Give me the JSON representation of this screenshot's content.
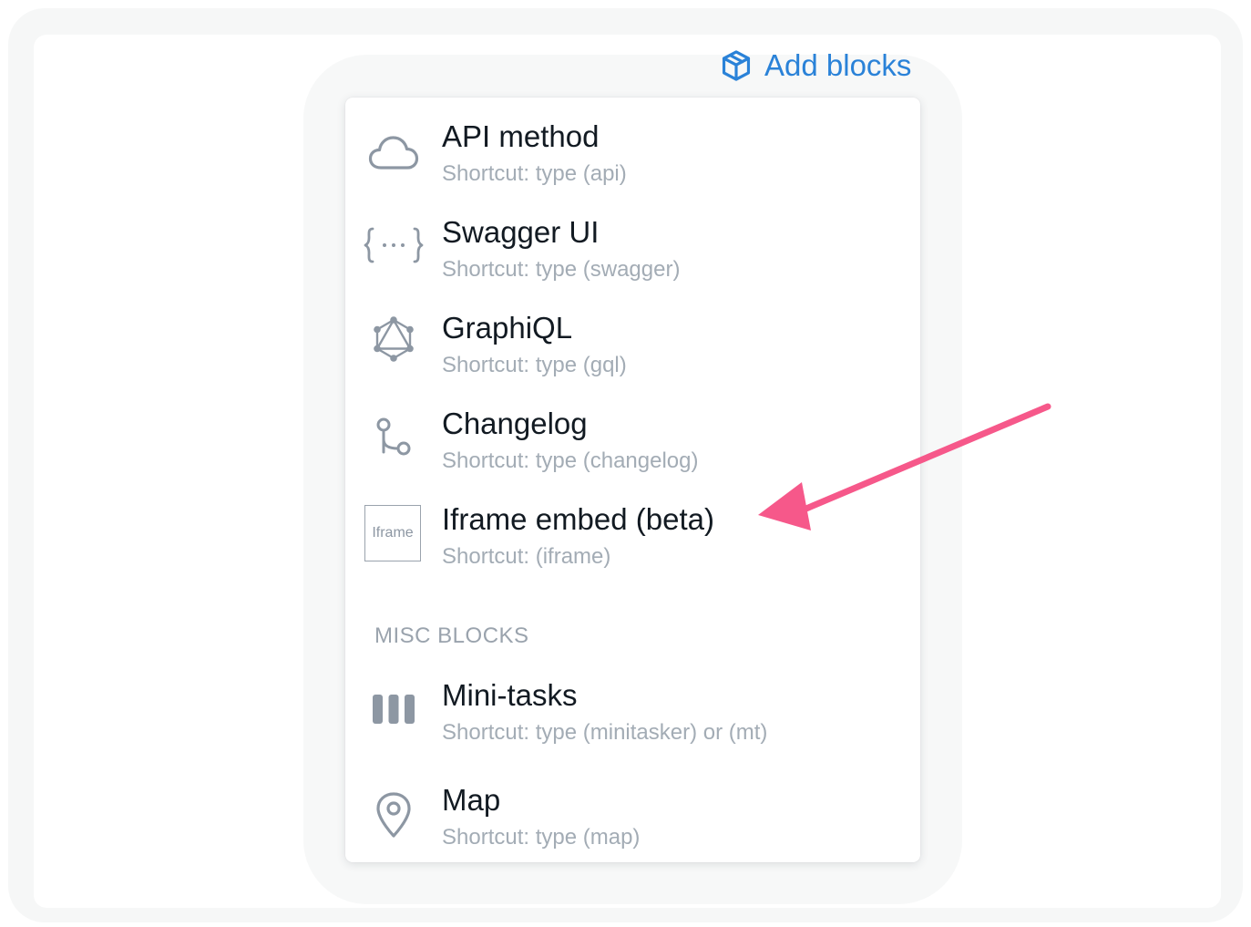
{
  "header": {
    "add_blocks_label": "Add blocks",
    "add_blocks_icon": "cube-icon",
    "accent_color": "#2a82d8"
  },
  "menu": {
    "items": [
      {
        "title": "API method",
        "shortcut": "Shortcut:  type (api)",
        "icon": "cloud-icon"
      },
      {
        "title": "Swagger UI",
        "shortcut": "Shortcut:  type (swagger)",
        "icon": "curly-braces-icon"
      },
      {
        "title": "GraphiQL",
        "shortcut": "Shortcut:  type (gql)",
        "icon": "graphql-icon"
      },
      {
        "title": "Changelog",
        "shortcut": "Shortcut:  type (changelog)",
        "icon": "git-branch-icon"
      },
      {
        "title": "Iframe embed (beta)",
        "shortcut": "Shortcut:  (iframe)",
        "icon": "iframe-icon",
        "icon_text": "Iframe"
      }
    ],
    "misc_section_label": "MISC BLOCKS",
    "misc_items": [
      {
        "title": "Mini-tasks",
        "shortcut": "Shortcut:  type (minitasker) or (mt)",
        "icon": "columns-icon"
      },
      {
        "title": "Map",
        "shortcut": "Shortcut:  type (map)",
        "icon": "map-pin-icon"
      }
    ]
  },
  "annotation": {
    "arrow_color": "#f6588a",
    "arrow_icon": "pointer-arrow-icon"
  }
}
